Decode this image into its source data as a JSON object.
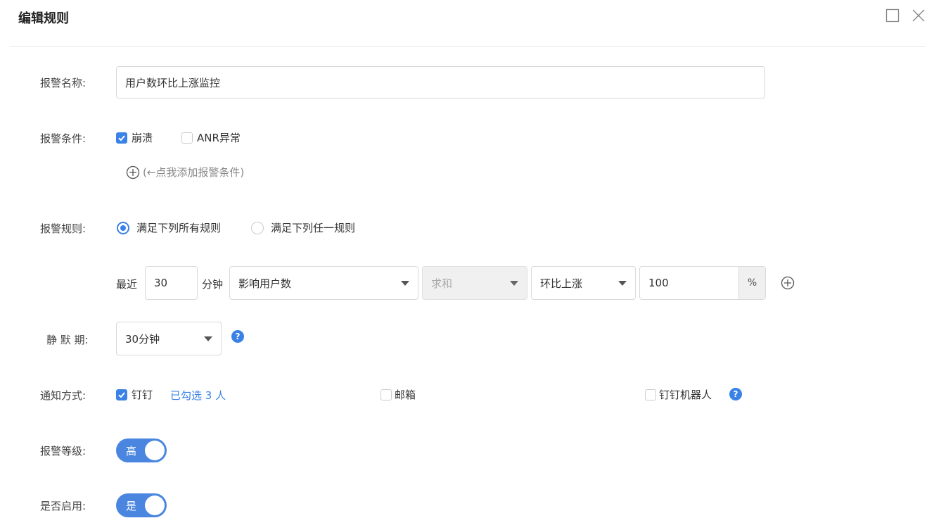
{
  "header": {
    "title": "编辑规则"
  },
  "form": {
    "alert_name": {
      "label": "报警名称:",
      "value": "用户数环比上涨监控"
    },
    "conditions": {
      "label": "报警条件:",
      "options": [
        {
          "label": "崩溃",
          "checked": true
        },
        {
          "label": "ANR异常",
          "checked": false
        }
      ],
      "add_hint": "(←点我添加报警条件)"
    },
    "rules": {
      "label": "报警规则:",
      "options": [
        {
          "label": "满足下列所有规则",
          "selected": true
        },
        {
          "label": "满足下列任一规则",
          "selected": false
        }
      ],
      "row": {
        "prefix": "最近",
        "minutes_value": "30",
        "minutes_unit": "分钟",
        "metric": "影响用户数",
        "aggregation": "求和",
        "comparison": "环比上涨",
        "threshold": "100",
        "threshold_unit": "%"
      }
    },
    "silence": {
      "label": "静 默 期:",
      "value": "30分钟",
      "help": "?"
    },
    "notify": {
      "label": "通知方式:",
      "options": [
        {
          "label": "钉钉",
          "checked": true
        },
        {
          "label": "邮箱",
          "checked": false
        },
        {
          "label": "钉钉机器人",
          "checked": false
        }
      ],
      "selected_link": "已勾选 3 人",
      "help": "?"
    },
    "level": {
      "label": "报警等级:",
      "toggle_text": "高",
      "on": true
    },
    "enabled": {
      "label": "是否启用:",
      "toggle_text": "是",
      "on": true
    }
  },
  "colors": {
    "accent": "#3b82e6",
    "toggle": "#4a86e0"
  }
}
